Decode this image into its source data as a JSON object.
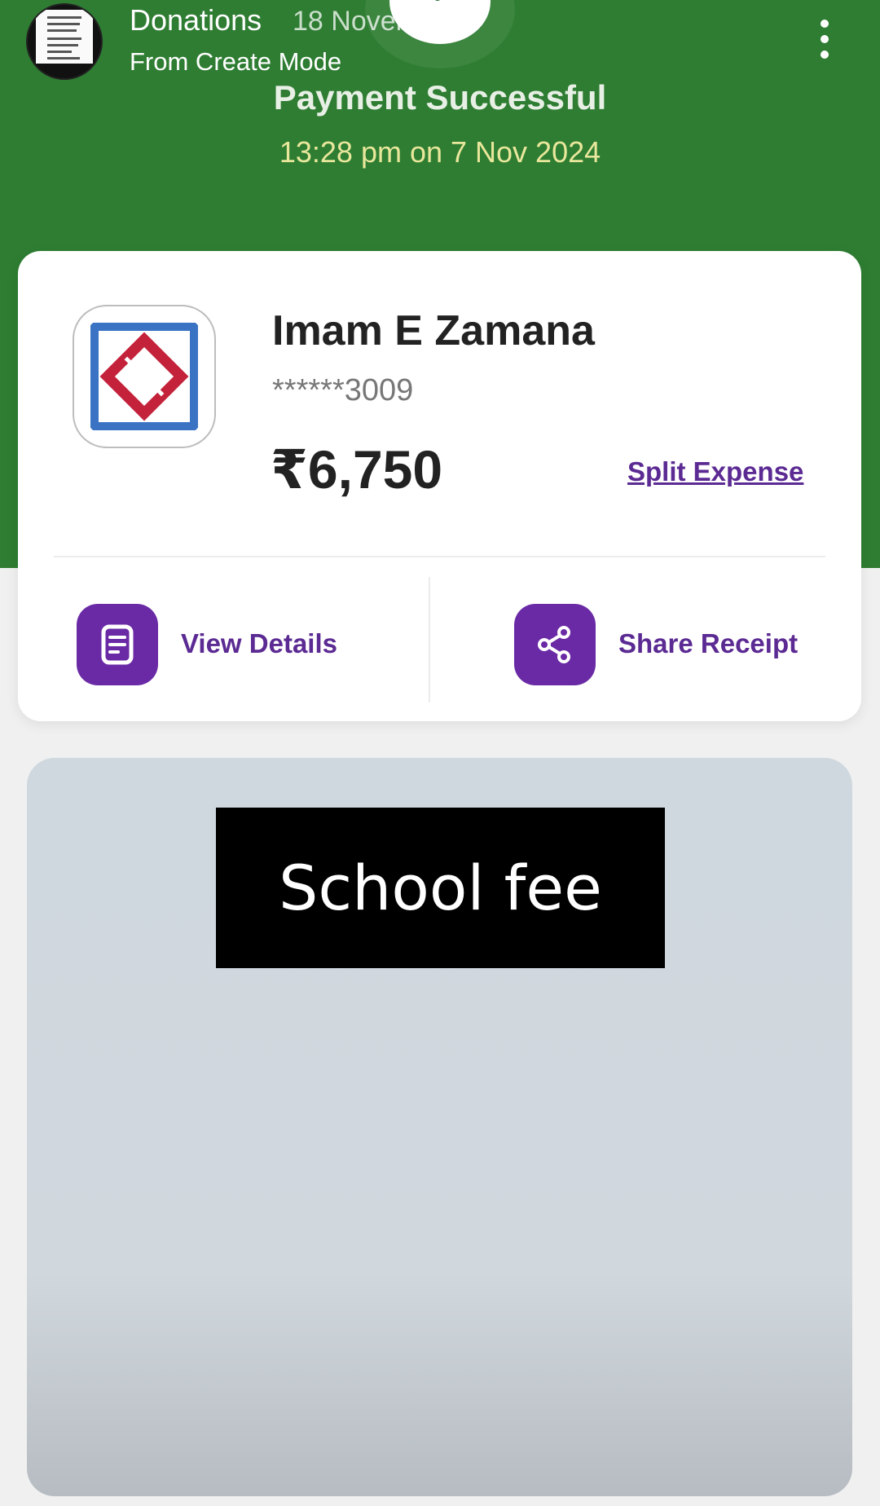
{
  "story_header": {
    "title": "Donations",
    "date": "18 November",
    "subtitle": "From Create Mode"
  },
  "payment": {
    "status_title": "Payment Successful",
    "timestamp": "13:28 pm on 7 Nov 2024"
  },
  "payee": {
    "name": "Imam E Zamana",
    "account": "******3009",
    "amount": "₹6,750",
    "split_label": "Split Expense"
  },
  "actions": [
    {
      "label": "View Details",
      "icon": "document-icon"
    },
    {
      "label": "Share Receipt",
      "icon": "share-icon"
    }
  ],
  "sticker": {
    "text": "School fee"
  },
  "colors": {
    "header_green": "#2e7d32",
    "accent_purple": "#6a2aa5",
    "link_purple": "#5b2a93",
    "timestamp_yellow": "#e9e79c"
  }
}
